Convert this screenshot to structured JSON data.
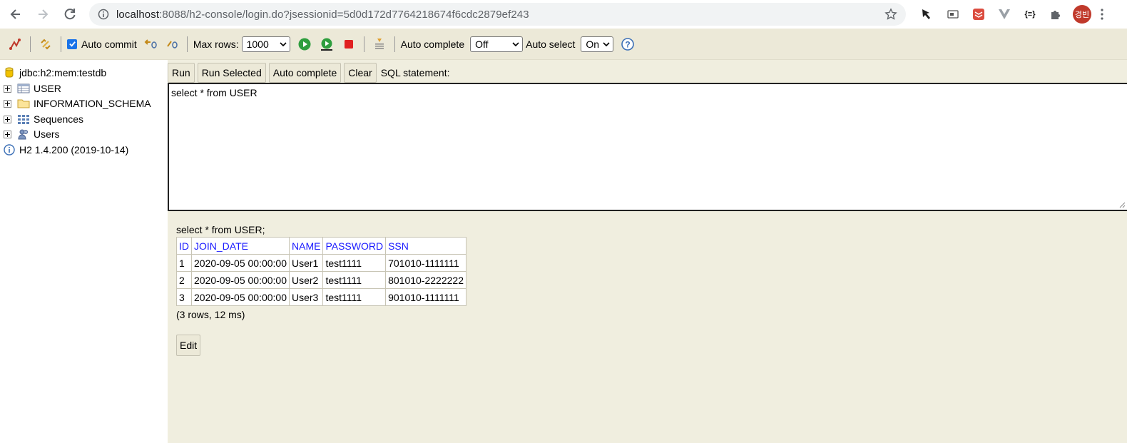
{
  "browser": {
    "url_host": "localhost",
    "url_rest": ":8088/h2-console/login.do?jsessionid=5d0d172d7764218674f6cdc2879ef243",
    "profile_initials": "경빈",
    "extension_badge": "{≡}"
  },
  "toolbar": {
    "auto_commit_label": "Auto commit",
    "auto_commit_checked": true,
    "max_rows_label": "Max rows:",
    "max_rows_value": "1000",
    "auto_complete_label": "Auto complete",
    "auto_complete_value": "Off",
    "auto_select_label": "Auto select",
    "auto_select_value": "On"
  },
  "tree": {
    "connection": "jdbc:h2:mem:testdb",
    "items": [
      {
        "label": "USER",
        "icon": "table-icon"
      },
      {
        "label": "INFORMATION_SCHEMA",
        "icon": "folder-icon"
      },
      {
        "label": "Sequences",
        "icon": "sequences-icon"
      },
      {
        "label": "Users",
        "icon": "users-icon"
      }
    ],
    "version": "H2 1.4.200 (2019-10-14)"
  },
  "actions": {
    "run": "Run",
    "run_selected": "Run Selected",
    "auto_complete": "Auto complete",
    "clear": "Clear",
    "sql_statement_label": "SQL statement:"
  },
  "editor": {
    "sql": "select * from USER"
  },
  "result": {
    "statement": "select * from USER;",
    "columns": [
      "ID",
      "JOIN_DATE",
      "NAME",
      "PASSWORD",
      "SSN"
    ],
    "rows": [
      [
        "1",
        "2020-09-05 00:00:00",
        "User1",
        "test1111",
        "701010-1111111"
      ],
      [
        "2",
        "2020-09-05 00:00:00",
        "User2",
        "test1111",
        "801010-2222222"
      ],
      [
        "3",
        "2020-09-05 00:00:00",
        "User3",
        "test1111",
        "901010-1111111"
      ]
    ],
    "summary": "(3 rows, 12 ms)",
    "edit_label": "Edit"
  }
}
